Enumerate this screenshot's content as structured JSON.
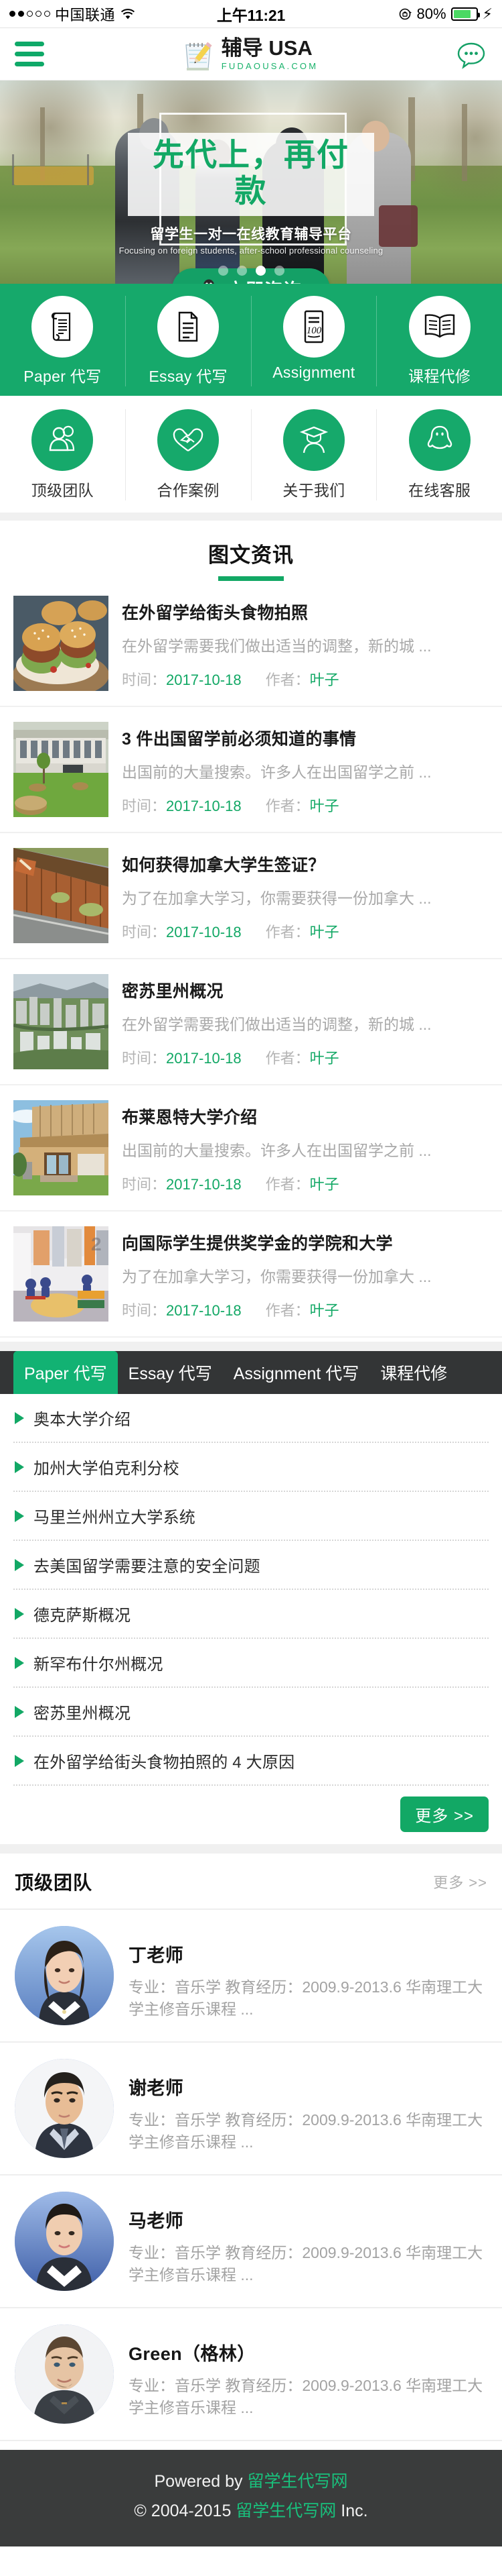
{
  "status_bar": {
    "signal_dots_filled": 2,
    "signal_dots_total": 5,
    "carrier": "中国联通",
    "wifi_icon": "wifi-icon",
    "time": "上午11:21",
    "lock_icon": "rotation-lock-icon",
    "battery_percent": "80%",
    "battery_level": 80,
    "charging_icon": "lightning-bolt-icon"
  },
  "header": {
    "menu_icon": "hamburger-menu-icon",
    "logo_icon": "notepad-pencil-icon",
    "logo_title": "辅导 USA",
    "logo_subtitle": "FUDAOUSA.COM",
    "chat_icon": "chat-bubble-icon"
  },
  "banner": {
    "headline": "先代上，再付款",
    "subline_cn": "留学生一对一在线教育辅导平台",
    "subline_en": "Focusing on foreign students, after-school professional counseling",
    "cta_icon": "qq-penguin-icon",
    "cta_label": "立即咨询",
    "dots_total": 4,
    "active_dot": 3
  },
  "service_green": {
    "items": [
      {
        "icon": "scroll-document-icon",
        "label": "Paper 代写"
      },
      {
        "icon": "text-document-icon",
        "label": "Essay 代写"
      },
      {
        "icon": "score-100-icon",
        "label": "Assignment"
      },
      {
        "icon": "open-book-icon",
        "label": "课程代修"
      }
    ]
  },
  "service_white": {
    "items": [
      {
        "icon": "two-people-icon",
        "label": "顶级团队"
      },
      {
        "icon": "handshake-heart-icon",
        "label": "合作案例"
      },
      {
        "icon": "graduation-cap-icon",
        "label": "关于我们"
      },
      {
        "icon": "qq-penguin-icon",
        "label": "在线客服"
      }
    ]
  },
  "news": {
    "heading": "图文资讯",
    "time_key": "时间：",
    "author_key": "作者：",
    "items": [
      {
        "thumb": "burger-food-photo",
        "title": "在外留学给街头食物拍照",
        "desc": "在外留学需要我们做出适当的调整，新的城 ...",
        "date": "2017-10-18",
        "author": "叶子"
      },
      {
        "thumb": "modern-campus-building-photo",
        "title": "3 件出国留学前必须知道的事情",
        "desc": "出国前的大量搜索。许多人在出国留学之前 ...",
        "date": "2017-10-18",
        "author": "叶子"
      },
      {
        "thumb": "rusted-wall-path-photo",
        "title": "如何获得加拿大学生签证？",
        "desc": "为了在加拿大学习，你需要获得一份加拿大 ...",
        "date": "2017-10-18",
        "author": "叶子"
      },
      {
        "thumb": "city-aerial-view-photo",
        "title": "密苏里州概况",
        "desc": "在外留学需要我们做出适当的调整，新的城 ...",
        "date": "2017-10-18",
        "author": "叶子"
      },
      {
        "thumb": "wooden-modern-house-photo",
        "title": "布莱恩特大学介绍",
        "desc": "出国前的大量搜索。许多人在出国留学之前 ...",
        "date": "2017-10-18",
        "author": "叶子"
      },
      {
        "thumb": "classroom-interior-photo",
        "title": "向国际学生提供奖学金的学院和大学",
        "desc": "为了在加拿大学习，你需要获得一份加拿大 ...",
        "date": "2017-10-18",
        "author": "叶子"
      }
    ]
  },
  "tab_panel": {
    "tabs": [
      {
        "label": "Paper 代写",
        "active": true
      },
      {
        "label": "Essay 代写",
        "active": false
      },
      {
        "label": "Assignment 代写",
        "active": false
      },
      {
        "label": "课程代修",
        "active": false
      }
    ],
    "bullet_icon": "triangle-right-icon",
    "rows": [
      "奥本大学介绍",
      "加州大学伯克利分校",
      "马里兰州州立大学系统",
      "去美国留学需要注意的安全问题",
      "德克萨斯概况",
      "新罕布什尔州概况",
      "密苏里州概况",
      "在外留学给街头食物拍照的 4 大原因"
    ],
    "more_label": "更多 >>"
  },
  "team": {
    "heading": "顶级团队",
    "more_label": "更多 >>",
    "members": [
      {
        "avatar": "female-teacher-portrait",
        "name": "丁老师",
        "desc": "专业：音乐学 教育经历：2009.9-2013.6 华南理工大学主修音乐课程 ..."
      },
      {
        "avatar": "male-teacher-portrait",
        "name": "谢老师",
        "desc": "专业：音乐学 教育经历：2009.9-2013.6 华南理工大学主修音乐课程 ..."
      },
      {
        "avatar": "female-teacher-portrait-2",
        "name": "马老师",
        "desc": "专业：音乐学 教育经历：2009.9-2013.6 华南理工大学主修音乐课程 ..."
      },
      {
        "avatar": "foreign-teacher-portrait",
        "name": "Green（格林）",
        "desc": "专业：音乐学 教育经历：2009.9-2013.6 华南理工大学主修音乐课程 ..."
      }
    ]
  },
  "footer": {
    "line1_prefix": "Powered by ",
    "line1_brand": "留学生代写网",
    "line2_prefix": "© 2004-2015 ",
    "line2_brand": "留学生代写网",
    "line2_suffix": " Inc."
  },
  "colors": {
    "brand_green": "#12a865",
    "green_block": "#16a96b",
    "tab_dark": "#333536",
    "footer_dark": "#3a3c3c",
    "footer_brand_green": "#19c07c",
    "battery_green": "#4bd964",
    "muted_text": "#a8a8a8"
  }
}
